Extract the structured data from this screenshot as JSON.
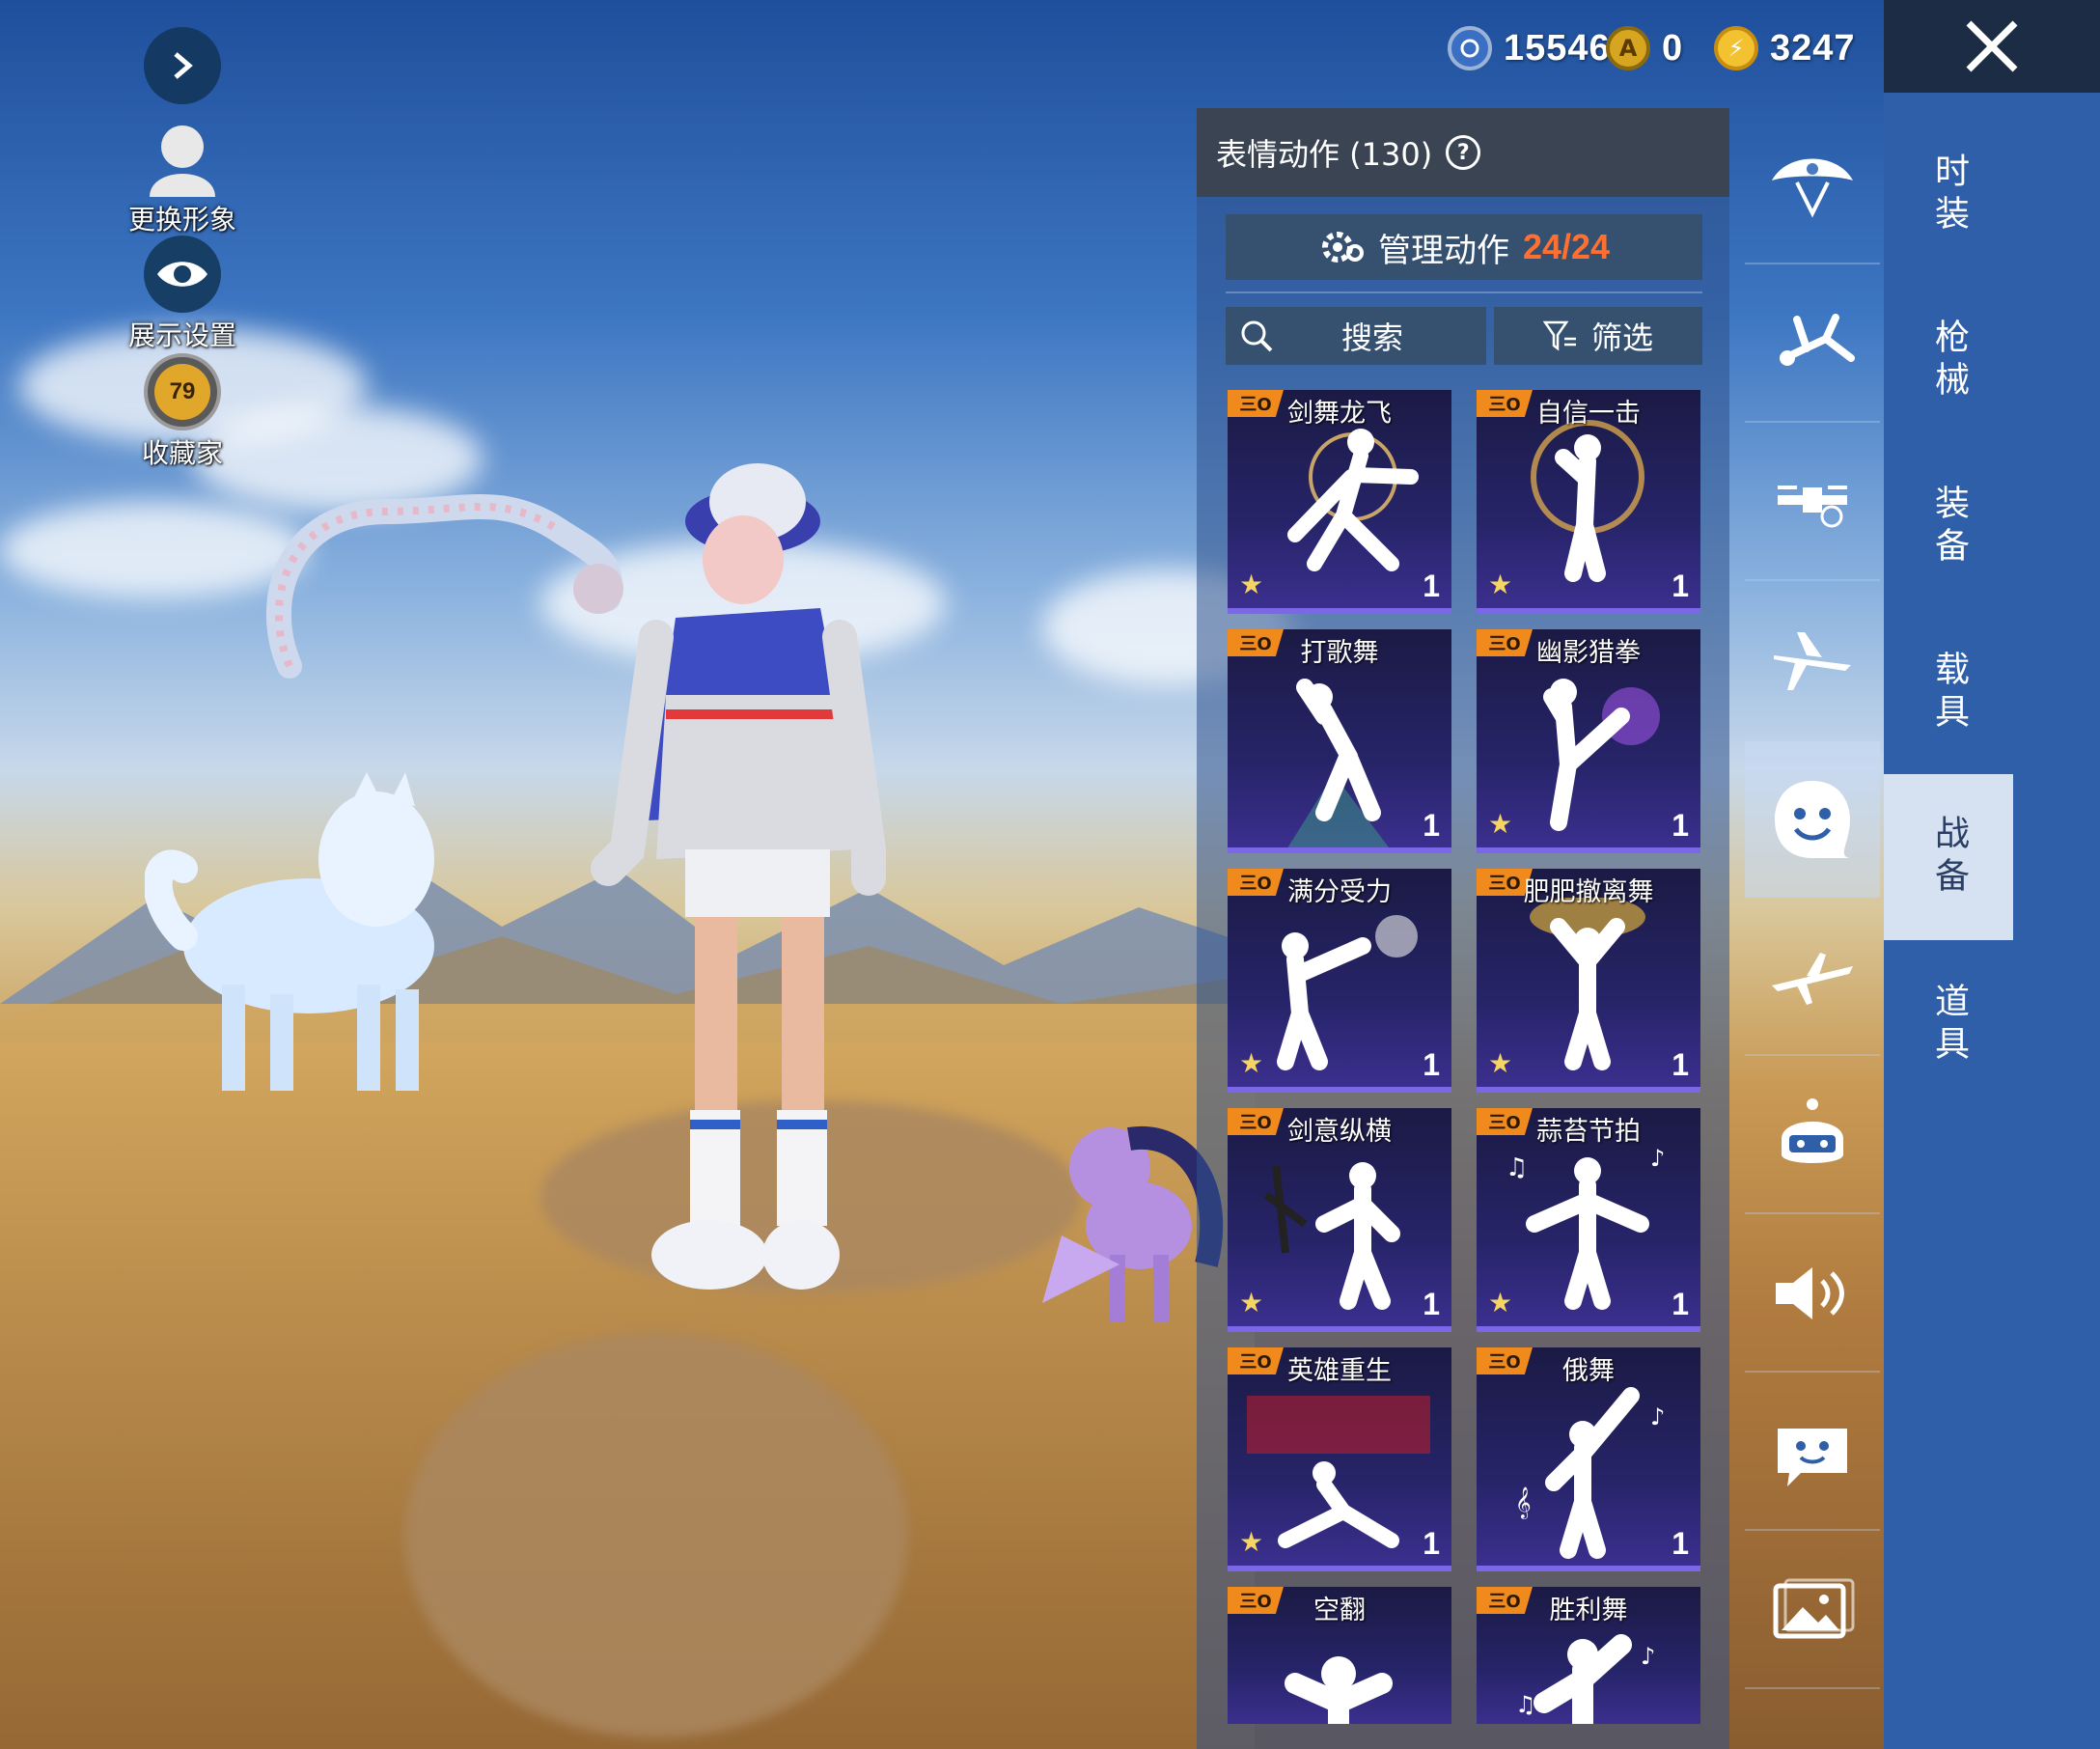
{
  "currencies": [
    {
      "icon": "uc-coin-icon",
      "value": "15546",
      "color": "#3a6fc4"
    },
    {
      "icon": "ag-coin-icon",
      "value": "0",
      "color": "#d8a520"
    },
    {
      "icon": "bp-coin-icon",
      "value": "3247",
      "color": "#f2c230"
    }
  ],
  "left_toolbar": {
    "expand_icon": "chevron-right-icon",
    "change_avatar": "更换形象",
    "display_settings": "展示设置",
    "collector": "收藏家",
    "collector_level": "79"
  },
  "panel": {
    "title": "表情动作 (130)",
    "help": "?",
    "manage_label": "管理动作",
    "manage_count": "24/24",
    "search_label": "搜索",
    "filter_label": "筛选",
    "emotes": [
      {
        "name": "剑舞龙飞",
        "count": "1"
      },
      {
        "name": "自信一击",
        "count": "1"
      },
      {
        "name": "打歌舞",
        "count": "1"
      },
      {
        "name": "幽影猎拳",
        "count": "1"
      },
      {
        "name": "满分受力",
        "count": "1"
      },
      {
        "name": "肥肥撤离舞",
        "count": "1"
      },
      {
        "name": "剑意纵横",
        "count": "1"
      },
      {
        "name": "蒜苔节拍",
        "count": "1"
      },
      {
        "name": "英雄重生",
        "count": "1"
      },
      {
        "name": "俄舞",
        "count": "1"
      },
      {
        "name": "空翻",
        "count": ""
      },
      {
        "name": "胜利舞",
        "count": ""
      }
    ],
    "badge": "三O"
  },
  "categories": [
    "parachute-icon",
    "skydive-pose-icon",
    "drone-icon",
    "plane-icon",
    "emote-face-icon",
    "glider-icon",
    "helmet-icon",
    "sound-icon",
    "chat-sticker-icon",
    "picture-icon"
  ],
  "active_category": 4,
  "tabs": [
    {
      "label": "时装"
    },
    {
      "label": "枪械"
    },
    {
      "label": "装备"
    },
    {
      "label": "载具"
    },
    {
      "label": "战备"
    },
    {
      "label": "道具"
    }
  ],
  "active_tab": 4,
  "colors": {
    "accent": "#ff7030",
    "badge": "#f08a1c",
    "emote_border": "#7c67e8"
  }
}
